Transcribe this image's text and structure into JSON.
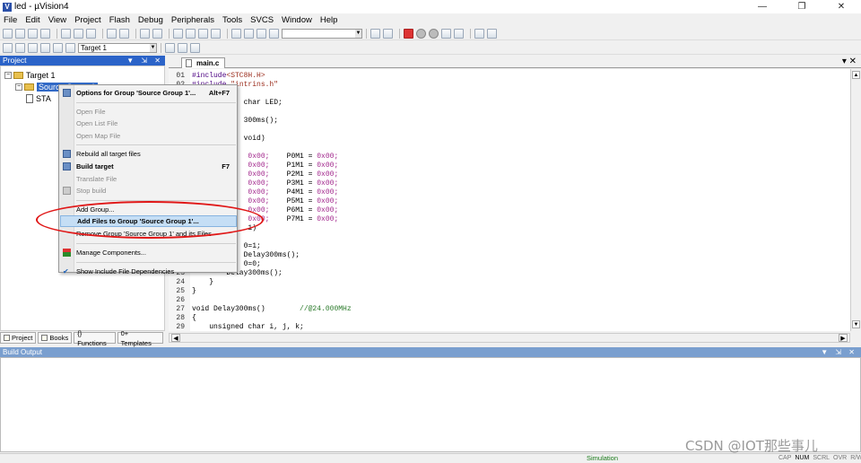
{
  "window": {
    "title": "led - µVision4",
    "min": "—",
    "max": "❐",
    "close": "✕"
  },
  "menubar": [
    "File",
    "Edit",
    "View",
    "Project",
    "Flash",
    "Debug",
    "Peripherals",
    "Tools",
    "SVCS",
    "Window",
    "Help"
  ],
  "toolbar": {
    "target_combo": "Target 1"
  },
  "project_panel": {
    "title": "Project",
    "controls": "▼ ⇲ ✕",
    "tree": {
      "root": "Target 1",
      "group": "Source Group 1",
      "file": "STA"
    },
    "tabs": [
      "Project",
      "Books",
      "{} Functions",
      "0+ Templates"
    ]
  },
  "editor": {
    "tab": "main.c",
    "lines": [
      {
        "n": "01",
        "segs": [
          [
            "#include",
            "pre"
          ],
          [
            "<STC8H.H>",
            "str"
          ]
        ]
      },
      {
        "n": "02",
        "segs": [
          [
            "#include ",
            "pre"
          ],
          [
            "\"intrins.h\"",
            "str"
          ]
        ]
      },
      {
        "n": "",
        "segs": [
          [
            "            char LED;",
            ""
          ]
        ]
      },
      {
        "n": "",
        "segs": [
          [
            "            300ms();",
            ""
          ]
        ]
      },
      {
        "n": "",
        "segs": [
          [
            "            void)",
            ""
          ]
        ]
      },
      {
        "n": "",
        "segs": [
          [
            "             ",
            ""
          ],
          [
            "0x00;",
            "hex"
          ],
          [
            "    P0M1 = ",
            ""
          ],
          [
            "0x00;",
            "hex"
          ]
        ]
      },
      {
        "n": "",
        "segs": [
          [
            "             ",
            ""
          ],
          [
            "0x00;",
            "hex"
          ],
          [
            "    P1M1 = ",
            ""
          ],
          [
            "0x00;",
            "hex"
          ]
        ]
      },
      {
        "n": "",
        "segs": [
          [
            "             ",
            ""
          ],
          [
            "0x00;",
            "hex"
          ],
          [
            "    P2M1 = ",
            ""
          ],
          [
            "0x00;",
            "hex"
          ]
        ]
      },
      {
        "n": "",
        "segs": [
          [
            "             ",
            ""
          ],
          [
            "0x00;",
            "hex"
          ],
          [
            "    P3M1 = ",
            ""
          ],
          [
            "0x00;",
            "hex"
          ]
        ]
      },
      {
        "n": "",
        "segs": [
          [
            "             ",
            ""
          ],
          [
            "0x00;",
            "hex"
          ],
          [
            "    P4M1 = ",
            ""
          ],
          [
            "0x00;",
            "hex"
          ]
        ]
      },
      {
        "n": "",
        "segs": [
          [
            "             ",
            ""
          ],
          [
            "0x00;",
            "hex"
          ],
          [
            "    P5M1 = ",
            ""
          ],
          [
            "0x00;",
            "hex"
          ]
        ]
      },
      {
        "n": "",
        "segs": [
          [
            "             ",
            ""
          ],
          [
            "0x00;",
            "hex"
          ],
          [
            "    P6M1 = ",
            ""
          ],
          [
            "0x00;",
            "hex"
          ]
        ]
      },
      {
        "n": "",
        "segs": [
          [
            "             ",
            ""
          ],
          [
            "0x00;",
            "hex"
          ],
          [
            "    P7M1 = ",
            ""
          ],
          [
            "0x00;",
            "hex"
          ]
        ]
      },
      {
        "n": "",
        "segs": [
          [
            "             1)",
            ""
          ]
        ]
      },
      {
        "n": "",
        "segs": [
          [
            "",
            ""
          ]
        ]
      },
      {
        "n": "",
        "segs": [
          [
            "            0=1;",
            ""
          ]
        ]
      },
      {
        "n": "",
        "segs": [
          [
            "            Delay300ms();",
            ""
          ]
        ]
      },
      {
        "n": "",
        "segs": [
          [
            "            0=0;",
            ""
          ]
        ]
      },
      {
        "n": "23",
        "segs": [
          [
            "        Delay300ms();",
            ""
          ]
        ]
      },
      {
        "n": "24",
        "segs": [
          [
            "    }",
            ""
          ]
        ]
      },
      {
        "n": "25",
        "segs": [
          [
            "}",
            ""
          ]
        ]
      },
      {
        "n": "26",
        "segs": [
          [
            "",
            ""
          ]
        ]
      },
      {
        "n": "27",
        "segs": [
          [
            "void Delay300ms()        ",
            ""
          ],
          [
            "//@24.000MHz",
            "cmt"
          ]
        ]
      },
      {
        "n": "28",
        "segs": [
          [
            "{",
            ""
          ]
        ]
      },
      {
        "n": "29",
        "segs": [
          [
            "    unsigned char i, j, k;",
            ""
          ]
        ]
      }
    ]
  },
  "context_menu": {
    "items": [
      {
        "label": "Options for Group 'Source Group 1'...",
        "shortcut": "Alt+F7",
        "state": "normal",
        "icon": "options-icon"
      },
      {
        "sep": true
      },
      {
        "label": "Open File",
        "state": "disabled"
      },
      {
        "label": "Open List File",
        "state": "disabled"
      },
      {
        "label": "Open Map File",
        "state": "disabled"
      },
      {
        "sep": true
      },
      {
        "label": "Rebuild all target files",
        "state": "normal",
        "icon": "rebuild-icon"
      },
      {
        "label": "Build target",
        "shortcut": "F7",
        "state": "normal",
        "icon": "build-icon"
      },
      {
        "label": "Translate File",
        "state": "disabled"
      },
      {
        "label": "Stop build",
        "state": "disabled",
        "icon": "stop-build-icon"
      },
      {
        "sep": true
      },
      {
        "label": "Add Group...",
        "state": "normal"
      },
      {
        "label": "Add Files to Group 'Source Group 1'...",
        "state": "highlighted"
      },
      {
        "label": "Remove Group 'Source Group 1' and its Files",
        "state": "normal"
      },
      {
        "sep": true
      },
      {
        "label": "Manage Components...",
        "state": "normal",
        "icon": "components-icon"
      },
      {
        "sep": true
      },
      {
        "label": "Show Include File Dependencies",
        "state": "checked",
        "icon": "check-icon"
      }
    ]
  },
  "build_output": {
    "title": "Build Output",
    "controls": "▼ ⇲ ✕"
  },
  "statusbar": {
    "simulation": "Simulation",
    "keys": [
      "CAP",
      "NUM",
      "SCRL",
      "OVR",
      "R/W"
    ],
    "active_keys": [
      "NUM"
    ]
  },
  "watermark": "CSDN @IOT那些事儿",
  "colors": {
    "selection": "#3169c6",
    "annotation": "#e01818",
    "menu_highlight": "#c5def5"
  }
}
